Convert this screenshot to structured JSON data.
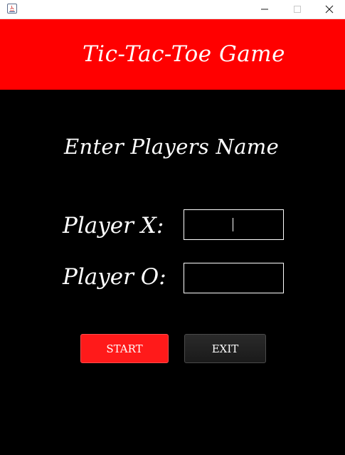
{
  "window": {
    "controls": {
      "minimize": "minimize-icon",
      "maximize": "maximize-icon",
      "close": "close-icon"
    }
  },
  "header": {
    "title": "Tic-Tac-Toe Game",
    "background": "#ff0000"
  },
  "form": {
    "subtitle": "Enter Players Name",
    "player_x_label": "Player X:",
    "player_x_value": "",
    "player_o_label": "Player O:",
    "player_o_value": ""
  },
  "buttons": {
    "start_label": "START",
    "exit_label": "EXIT",
    "start_color": "#ff1a1a",
    "exit_color": "#222222"
  }
}
